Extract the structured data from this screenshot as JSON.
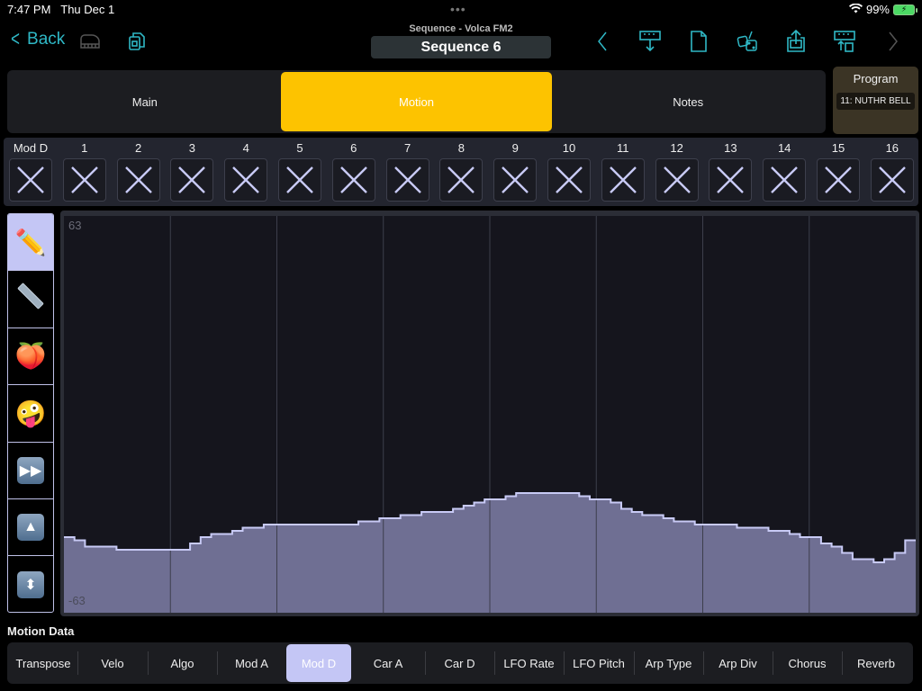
{
  "status_bar": {
    "time": "7:47 PM",
    "date": "Thu Dec 1",
    "battery": "99%"
  },
  "nav": {
    "back_label": "Back",
    "subtitle": "Sequence - Volca FM2",
    "title": "Sequence 6",
    "icons": [
      "keyboard-icon",
      "copy-documents-icon",
      "previous-icon",
      "import-icon",
      "new-document-icon",
      "randomize-dice-icon",
      "share-icon",
      "export-icon",
      "next-icon"
    ]
  },
  "tabs": [
    {
      "label": "Main",
      "active": false
    },
    {
      "label": "Motion",
      "active": true
    },
    {
      "label": "Notes",
      "active": false
    }
  ],
  "program": {
    "label": "Program",
    "value": "11: NUTHR BELL"
  },
  "steps": {
    "labels": [
      "Mod D",
      "1",
      "2",
      "3",
      "4",
      "5",
      "6",
      "7",
      "8",
      "9",
      "10",
      "11",
      "12",
      "13",
      "14",
      "15",
      "16"
    ]
  },
  "tools": [
    {
      "name": "pencil-tool",
      "glyph": "✏️",
      "active": true
    },
    {
      "name": "line-tool",
      "glyph": "ruler",
      "active": false
    },
    {
      "name": "peach-tool",
      "glyph": "🍑",
      "active": false
    },
    {
      "name": "crazy-face-tool",
      "glyph": "🤪",
      "active": false
    },
    {
      "name": "fast-forward-tool",
      "glyph": "⏩",
      "active": false
    },
    {
      "name": "scale-up-tool",
      "glyph": "⏫",
      "active": false
    },
    {
      "name": "expand-vertical-tool",
      "glyph": "↕",
      "active": false
    }
  ],
  "chart_data": {
    "type": "area",
    "title": "",
    "xlabel": "",
    "ylabel": "",
    "y_max_label": "63",
    "y_min_label": "-63",
    "ylim": [
      -63,
      63
    ],
    "steps": 16,
    "substeps_per_step": 5,
    "values": [
      -39,
      -40,
      -42,
      -42,
      -42,
      -43,
      -43,
      -43,
      -43,
      -43,
      -43,
      -43,
      -41,
      -39,
      -38,
      -38,
      -37,
      -36,
      -36,
      -35,
      -35,
      -35,
      -35,
      -35,
      -35,
      -35,
      -35,
      -35,
      -34,
      -34,
      -33,
      -33,
      -32,
      -32,
      -31,
      -31,
      -31,
      -30,
      -29,
      -28,
      -27,
      -27,
      -26,
      -25,
      -25,
      -25,
      -25,
      -25,
      -25,
      -26,
      -27,
      -27,
      -28,
      -30,
      -31,
      -32,
      -32,
      -33,
      -34,
      -34,
      -35,
      -35,
      -35,
      -35,
      -36,
      -36,
      -36,
      -37,
      -37,
      -38,
      -39,
      -39,
      -41,
      -42,
      -44,
      -46,
      -46,
      -47,
      -46,
      -44
    ],
    "last_value": -40,
    "fill_color": "#6f6f93",
    "line_color": "#c8caf5",
    "grid_lines": "vertical, one per step group of 2"
  },
  "motion_data": {
    "label": "Motion Data",
    "items": [
      {
        "label": "Transpose",
        "active": false
      },
      {
        "label": "Velo",
        "active": false
      },
      {
        "label": "Algo",
        "active": false
      },
      {
        "label": "Mod A",
        "active": false
      },
      {
        "label": "Mod D",
        "active": true
      },
      {
        "label": "Car A",
        "active": false
      },
      {
        "label": "Car D",
        "active": false
      },
      {
        "label": "LFO Rate",
        "active": false
      },
      {
        "label": "LFO Pitch",
        "active": false
      },
      {
        "label": "Arp Type",
        "active": false
      },
      {
        "label": "Arp Div",
        "active": false
      },
      {
        "label": "Chorus",
        "active": false
      },
      {
        "label": "Reverb",
        "active": false
      }
    ]
  }
}
